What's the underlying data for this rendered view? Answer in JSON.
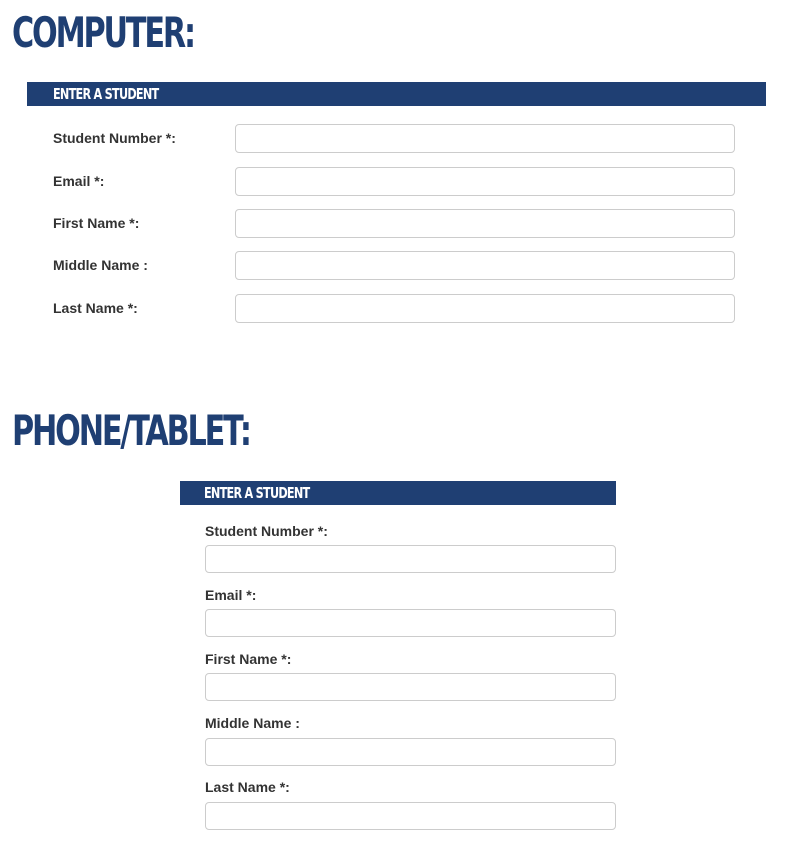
{
  "colors": {
    "brand_navy": "#1f3f73",
    "label_text": "#333333",
    "input_border": "#cccccc"
  },
  "computer": {
    "heading": "COMPUTER:",
    "panel_title": "ENTER A STUDENT",
    "fields": [
      {
        "label": "Student Number *:",
        "value": ""
      },
      {
        "label": "Email *:",
        "value": ""
      },
      {
        "label": "First Name *:",
        "value": ""
      },
      {
        "label": "Middle Name :",
        "value": ""
      },
      {
        "label": "Last Name *:",
        "value": ""
      }
    ]
  },
  "phone_tablet": {
    "heading": "PHONE/TABLET:",
    "panel_title": "ENTER A STUDENT",
    "fields": [
      {
        "label": "Student Number *:",
        "value": ""
      },
      {
        "label": "Email *:",
        "value": ""
      },
      {
        "label": "First Name *:",
        "value": ""
      },
      {
        "label": "Middle Name :",
        "value": ""
      },
      {
        "label": "Last Name *:",
        "value": ""
      }
    ]
  }
}
